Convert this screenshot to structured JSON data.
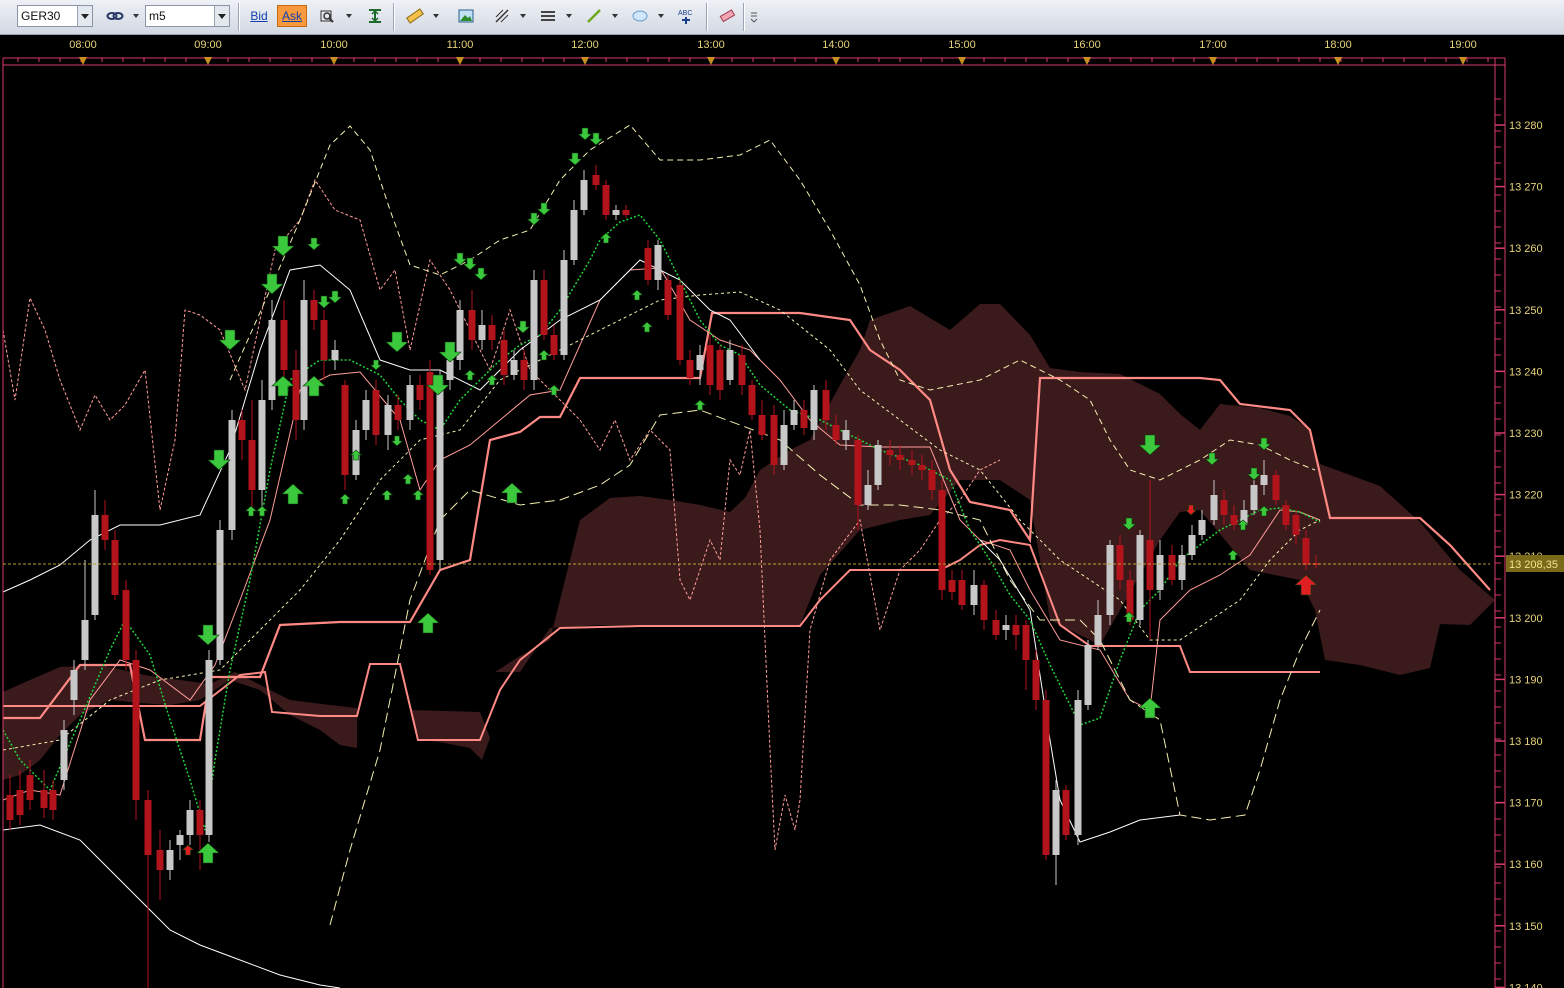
{
  "toolbar": {
    "symbol": "GER30",
    "timeframe": "m5",
    "bid_label": "Bid",
    "ask_label": "Ask",
    "active_price": "Ask",
    "icons": [
      "link-icon",
      "zoom-icon",
      "fit-icon",
      "ruler-icon",
      "image-icon",
      "crosshair-icon",
      "indicator-list-icon",
      "trendline-icon",
      "ellipse-icon",
      "text-label-icon",
      "eraser-icon",
      "more-icon"
    ]
  },
  "chart": {
    "time_labels": [
      "08:00",
      "09:00",
      "10:00",
      "11:00",
      "12:00",
      "13:00",
      "14:00",
      "15:00",
      "16:00",
      "17:00",
      "18:00",
      "19:00"
    ],
    "price_labels": [
      "13 280",
      "13 270",
      "13 260",
      "13 250",
      "13 240",
      "13 230",
      "13 220",
      "13 210",
      "13 200",
      "13 190",
      "13 180",
      "13 170",
      "13 160",
      "13 150",
      "13 140"
    ],
    "current_price_label": "13 208,35",
    "colors": {
      "background": "#000000",
      "frame": "#d93a6a",
      "axis_text": "#e6d27a",
      "bull_candle": "#c8c8c8",
      "bear_candle": "#b3131b",
      "cloud": "#3b1a1c",
      "kijun": "#ff8a85",
      "tenkan": "#ff9d9a",
      "bollinger": "#f4efb0",
      "ma_green": "#22d43a",
      "arrow_green": "#3cc83c",
      "arrow_red": "#e01f22",
      "price_line": "#b8a035"
    }
  }
}
